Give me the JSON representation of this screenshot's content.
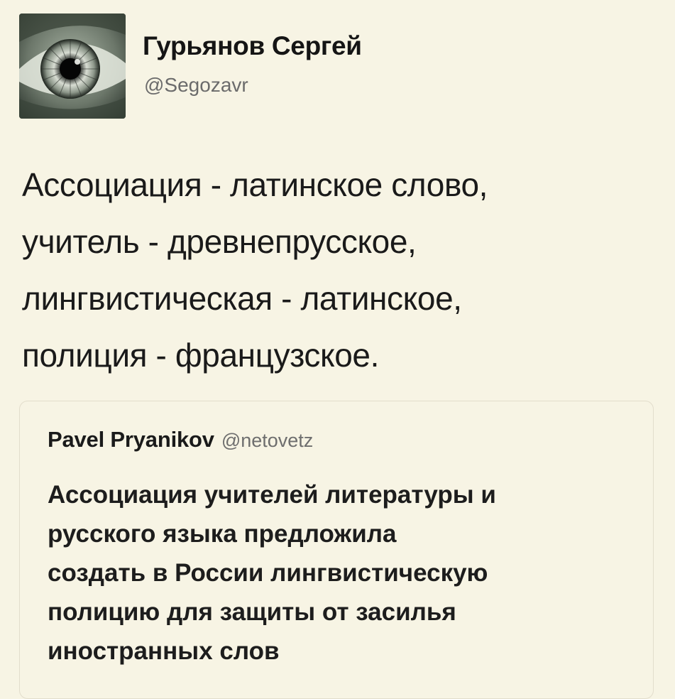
{
  "tweet": {
    "author": {
      "name": "Гурьянов Сергей",
      "handle": "@Segozavr",
      "avatar": "eye-closeup-avatar"
    },
    "text_lines": [
      "Ассоциация - латинское слово,",
      "учитель - древнепрусское,",
      "лингвистическая - латинское,",
      "полиция - французское."
    ]
  },
  "quoted_tweet": {
    "author": {
      "name": "Pavel Pryanikov",
      "handle": "@netovetz"
    },
    "text_lines": [
      "Ассоциация учителей литературы и",
      "русского языка предложила",
      "создать в России лингвистическую",
      "полицию для защиты от засилья",
      "иностранных слов"
    ]
  },
  "colors": {
    "background": "#f7f4e4",
    "text": "#1a1a1a",
    "handle": "#6b6b6b",
    "quote_border": "#e2ddcc"
  }
}
